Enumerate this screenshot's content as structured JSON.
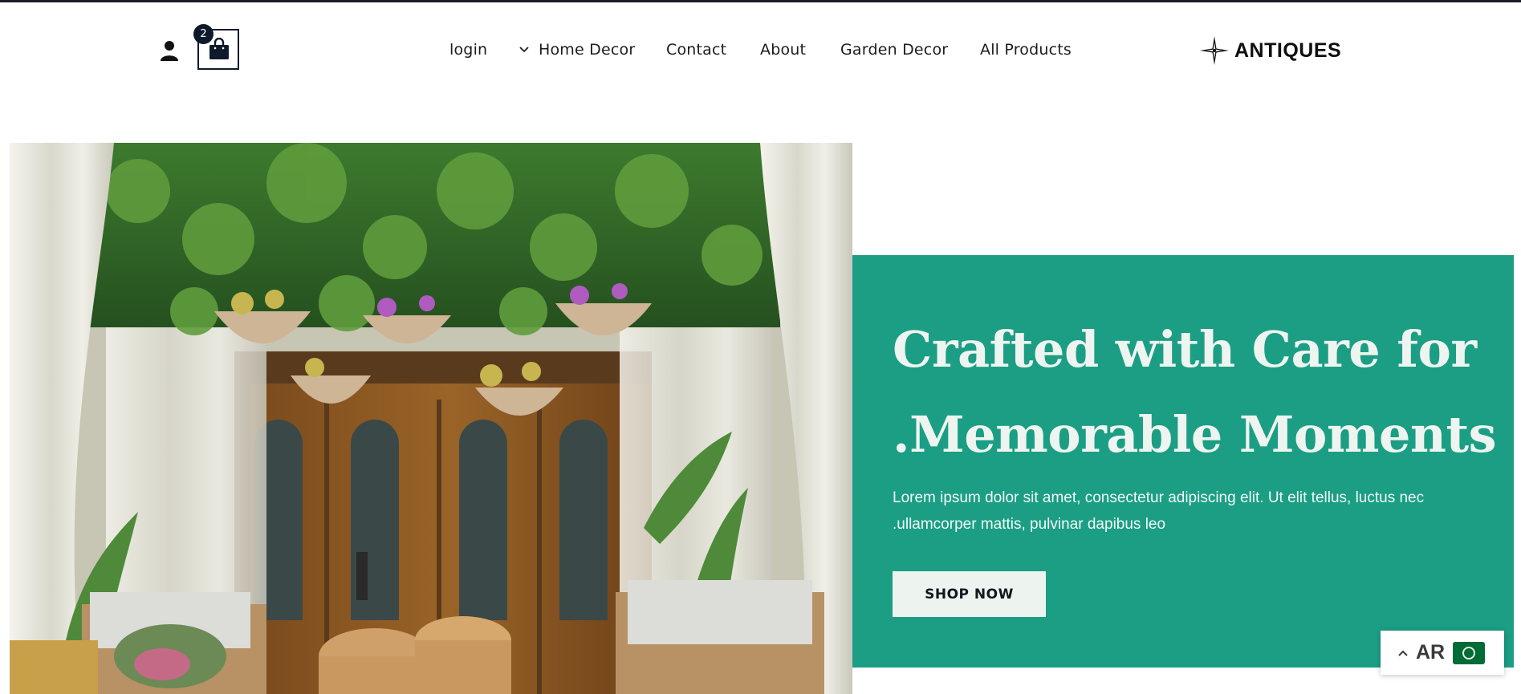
{
  "header": {
    "cart_count": "2",
    "nav": [
      {
        "label": "login"
      },
      {
        "label": "Home Decor"
      },
      {
        "label": "Contact"
      },
      {
        "label": "About"
      },
      {
        "label": "Garden Decor"
      },
      {
        "label": "All Products"
      }
    ],
    "brand": "ANTIQUES"
  },
  "hero": {
    "title_line1": "Crafted with Care for",
    "title_line2": ".Memorable Moments",
    "desc_line1": "Lorem ipsum dolor sit amet, consectetur adipiscing elit. Ut elit tellus, luctus nec",
    "desc_line2": ".ullamcorper mattis, pulvinar dapibus leo",
    "button": "SHOP NOW",
    "panel_color": "#1b9e84"
  },
  "language": {
    "code": "AR",
    "flag": "saudi-arabia-flag"
  }
}
